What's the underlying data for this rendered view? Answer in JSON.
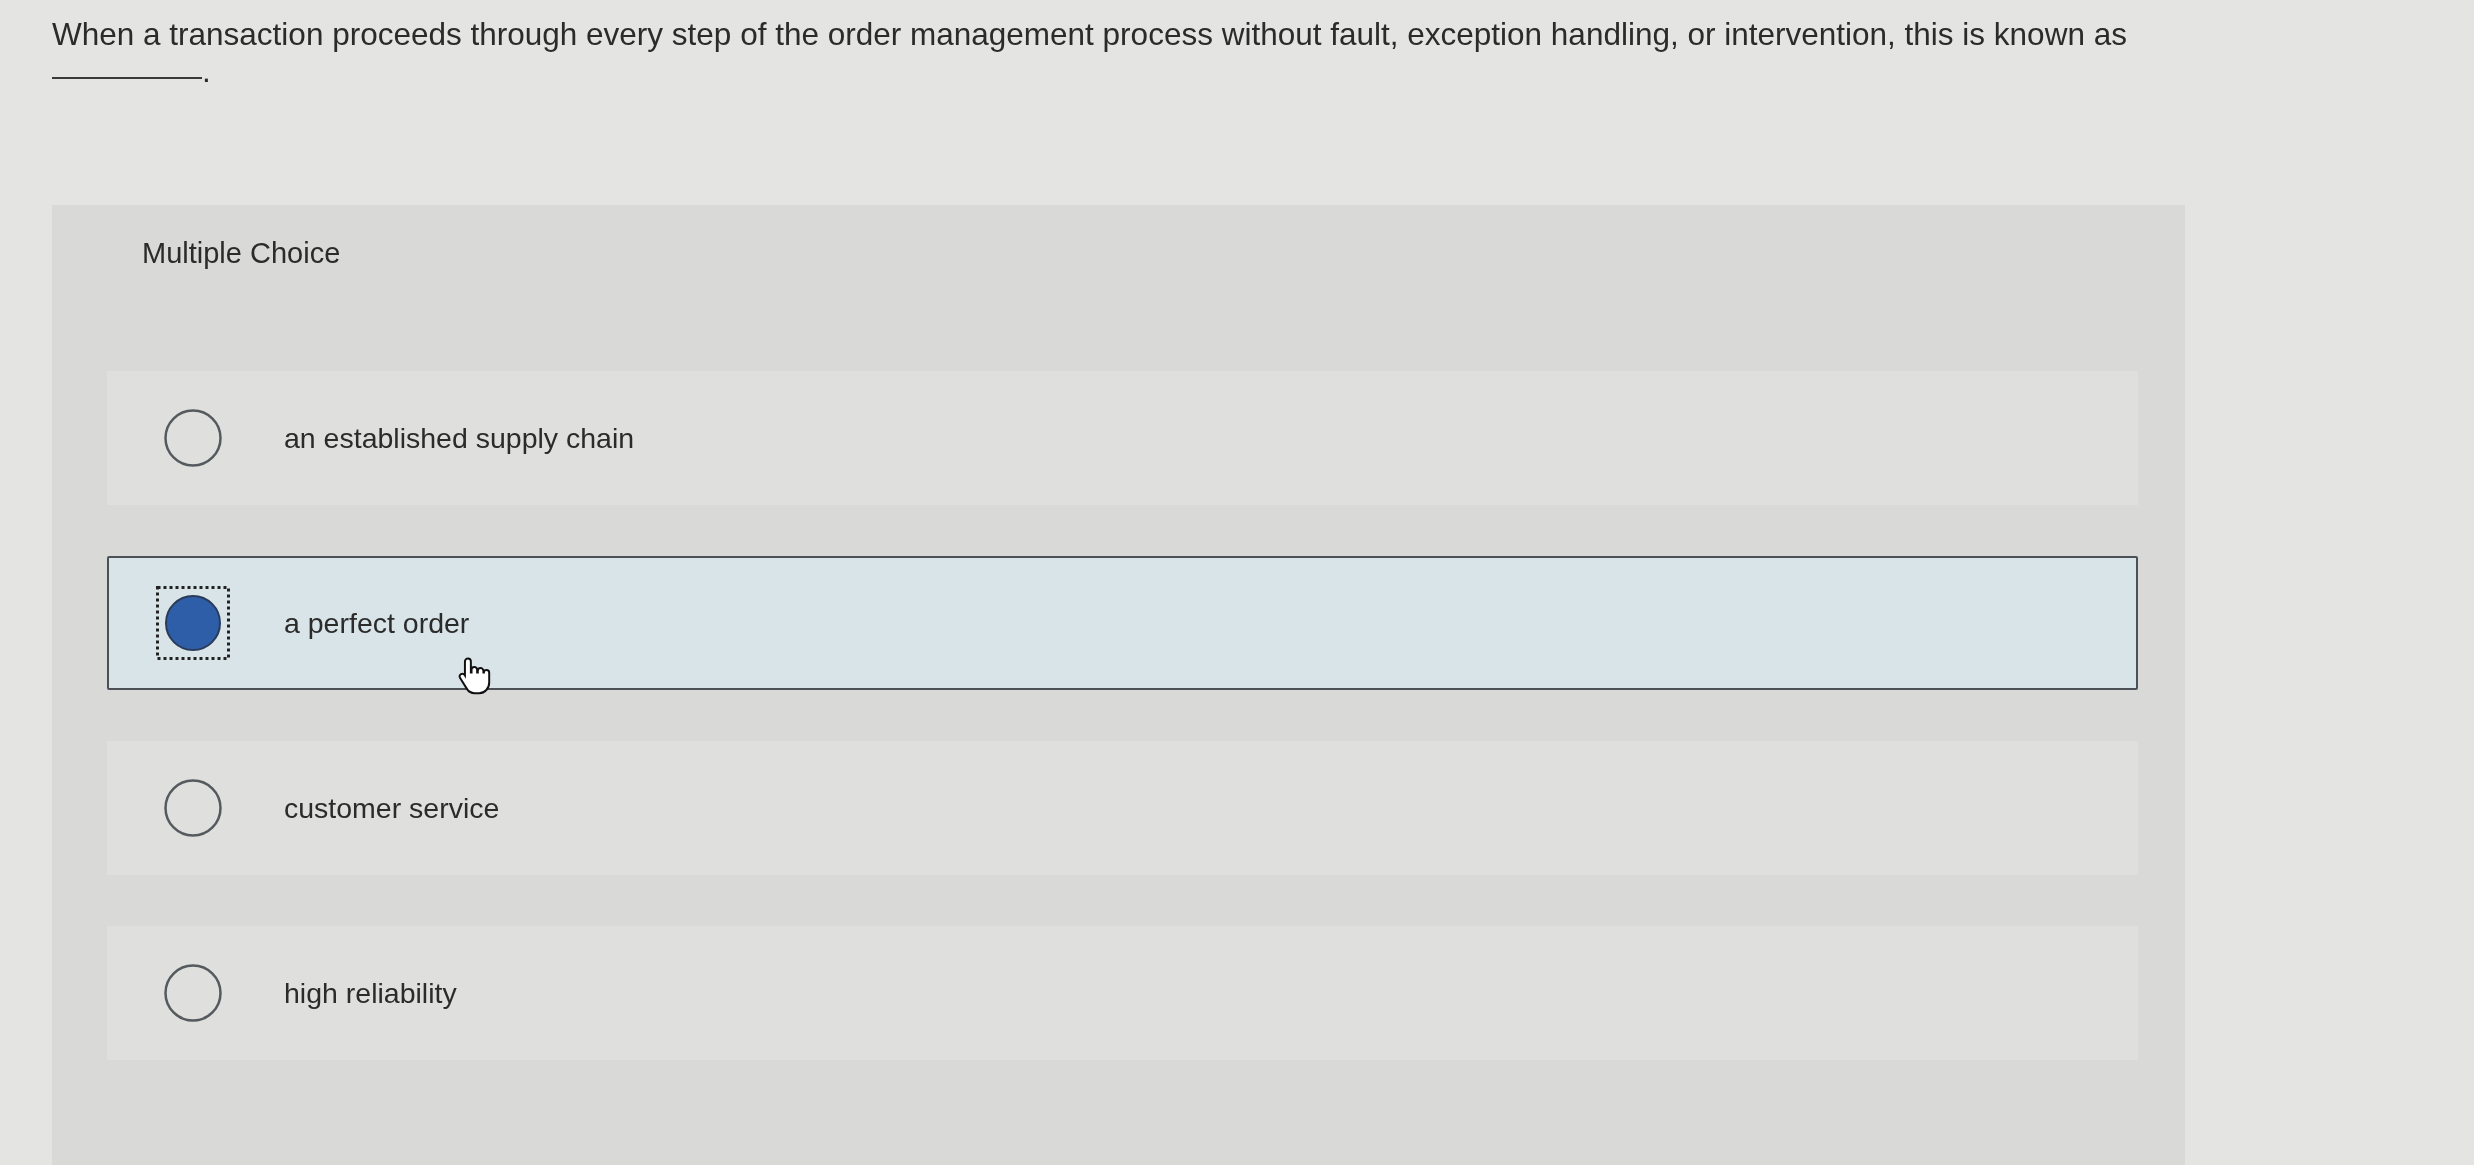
{
  "question": {
    "text": "When a transaction proceeds through every step of the order management process without fault, exception handling, or intervention, this is known as",
    "after_blank": "."
  },
  "panel": {
    "title": "Multiple Choice"
  },
  "options": [
    {
      "label": "an established supply chain",
      "selected": false,
      "focused": false
    },
    {
      "label": "a perfect order",
      "selected": true,
      "focused": true
    },
    {
      "label": "customer service",
      "selected": false,
      "focused": false
    },
    {
      "label": "high reliability",
      "selected": false,
      "focused": false
    }
  ]
}
